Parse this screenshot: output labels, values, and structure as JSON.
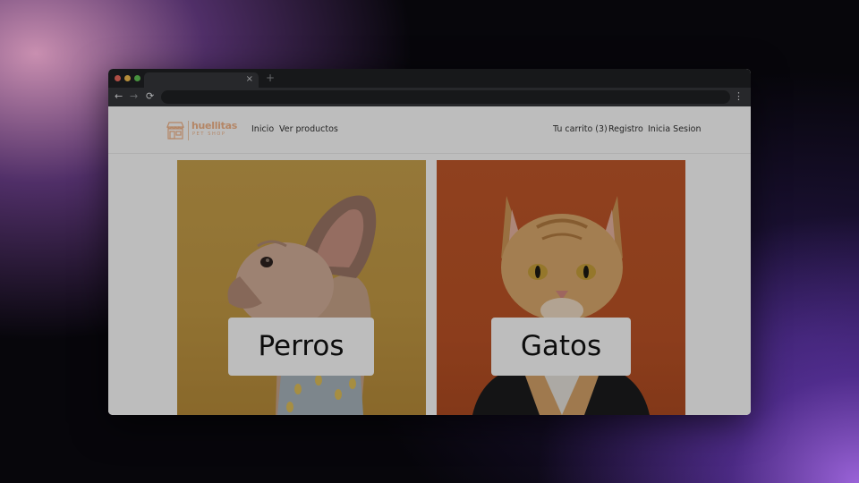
{
  "browser": {
    "tab_close": "×",
    "new_tab": "+",
    "back": "←",
    "forward": "→",
    "reload": "⟳",
    "menu": "⋮"
  },
  "site": {
    "logo": {
      "name": "huellitas",
      "tagline": "PET SHOP"
    },
    "nav_left": [
      "Inicio",
      "Ver productos"
    ],
    "nav_right": [
      "Tu carrito (3)",
      "Registro",
      "Inicia Sesion"
    ]
  },
  "categories": [
    {
      "label": "Perros",
      "image": "french-bulldog-photo"
    },
    {
      "label": "Gatos",
      "image": "orange-tabby-cat-photo"
    }
  ],
  "colors": {
    "brand": "#f3b58a",
    "dog_bg": "#c49a44",
    "cat_bg": "#bd5326",
    "chrome_dark": "#202124",
    "chrome_toolbar": "#35363a"
  }
}
